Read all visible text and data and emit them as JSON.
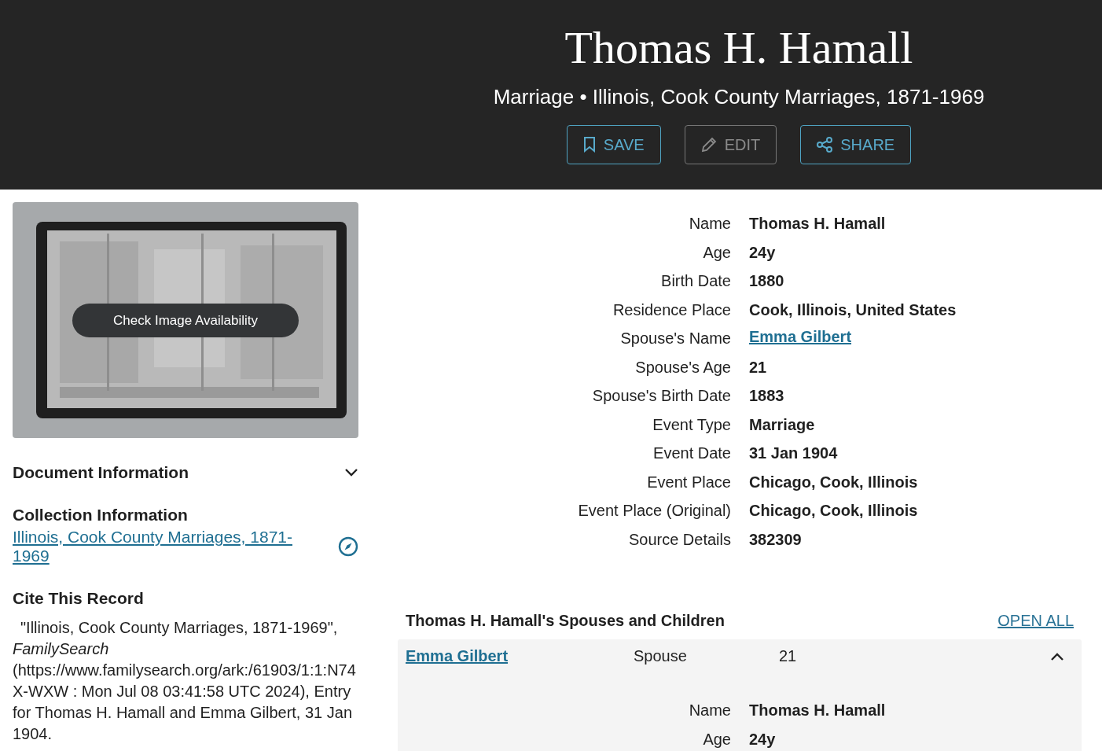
{
  "header": {
    "title": "Thomas H. Hamall",
    "subtitle": "Marriage • Illinois, Cook County Marriages, 1871-1969",
    "actions": [
      {
        "kind": "save",
        "label": "SAVE",
        "disabled": false
      },
      {
        "kind": "edit",
        "label": "EDIT",
        "disabled": true
      },
      {
        "kind": "share",
        "label": "SHARE",
        "disabled": false
      }
    ]
  },
  "image_panel": {
    "button": "Check Image Availability"
  },
  "document_information": {
    "title": "Document Information",
    "expanded": false
  },
  "collection_information": {
    "title": "Collection Information",
    "link": "Illinois, Cook County Marriages, 1871-1969"
  },
  "cite": {
    "title": "Cite This Record",
    "text": "\"Illinois, Cook County Marriages, 1871-1969\", *FamilySearch* (https://www.familysearch.org/ark:/61903/1:1:N74X-WXW : Mon Jul 08 03:41:58 UTC 2024), Entry for Thomas H. Hamall and Emma Gilbert, 31 Jan 1904."
  },
  "facts": [
    {
      "label": "Name",
      "value": "Thomas H. Hamall",
      "kind": "text"
    },
    {
      "label": "Age",
      "value": "24y",
      "kind": "text"
    },
    {
      "label": "Birth Date",
      "value": "1880",
      "kind": "text"
    },
    {
      "label": "Residence Place",
      "value": "Cook, Illinois, United States",
      "kind": "text"
    },
    {
      "label": "Spouse's Name",
      "value": "Emma Gilbert",
      "kind": "link"
    },
    {
      "label": "Spouse's Age",
      "value": "21",
      "kind": "text"
    },
    {
      "label": "Spouse's Birth Date",
      "value": "1883",
      "kind": "text"
    },
    {
      "label": "Event Type",
      "value": "Marriage",
      "kind": "text"
    },
    {
      "label": "Event Date",
      "value": "31 Jan 1904",
      "kind": "text"
    },
    {
      "label": "Event Place",
      "value": "Chicago, Cook, Illinois",
      "kind": "text"
    },
    {
      "label": "Event Place (Original)",
      "value": "Chicago, Cook, Illinois",
      "kind": "text"
    },
    {
      "label": "Source Details",
      "value": "382309",
      "kind": "text"
    }
  ],
  "family": {
    "title": "Thomas H. Hamall's Spouses and Children",
    "open_all": "OPEN ALL",
    "members": [
      {
        "name": "Emma Gilbert",
        "relationship": "Spouse",
        "age": "21",
        "expanded": true,
        "facts": [
          {
            "label": "Name",
            "value": "Thomas H. Hamall"
          },
          {
            "label": "Age",
            "value": "24y"
          }
        ]
      }
    ]
  }
}
